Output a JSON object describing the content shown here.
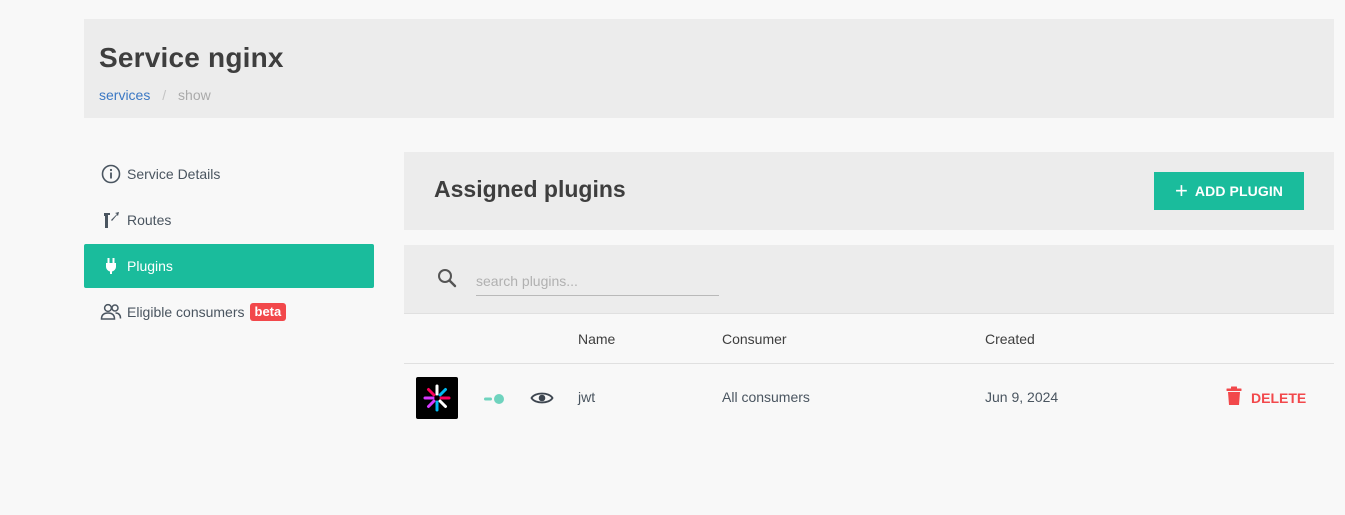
{
  "header": {
    "title": "Service nginx",
    "breadcrumb": {
      "link": "services",
      "separator": "/",
      "current": "show"
    }
  },
  "sidebar": {
    "items": [
      {
        "label": "Service Details",
        "icon": "info-circle-icon",
        "active": false
      },
      {
        "label": "Routes",
        "icon": "routes-fork-icon",
        "active": false
      },
      {
        "label": "Plugins",
        "icon": "plug-icon",
        "active": true
      },
      {
        "label": "Eligible consumers",
        "icon": "users-icon",
        "active": false,
        "badge": "beta"
      }
    ]
  },
  "plugins": {
    "title": "Assigned plugins",
    "add_button": "ADD PLUGIN",
    "search": {
      "placeholder": "search plugins..."
    },
    "columns": [
      "Name",
      "Consumer",
      "Created"
    ],
    "rows": [
      {
        "icon": "jwt-logo-icon",
        "enabled": true,
        "name": "jwt",
        "consumer": "All consumers",
        "created": "Jun 9, 2024",
        "delete_label": "DELETE"
      }
    ]
  },
  "colors": {
    "accent": "#1abc9c",
    "danger": "#f2484b",
    "link": "#3b78c4",
    "panel": "#ececec"
  }
}
